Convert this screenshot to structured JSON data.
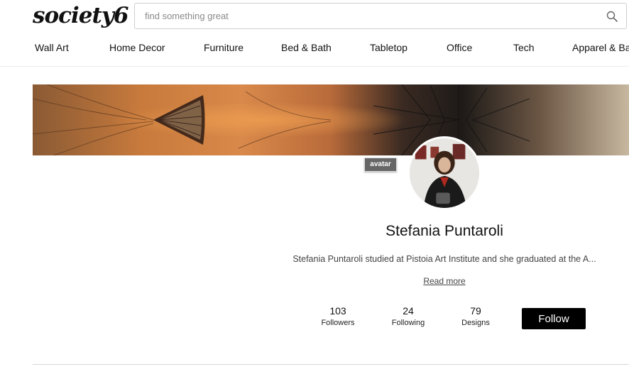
{
  "brand": {
    "logo_text": "society6"
  },
  "search": {
    "placeholder": "find something great",
    "value": ""
  },
  "nav": {
    "items": [
      "Wall Art",
      "Home Decor",
      "Furniture",
      "Bed & Bath",
      "Tabletop",
      "Office",
      "Tech",
      "Apparel & Bags"
    ]
  },
  "profile": {
    "avatar_tag": "avatar",
    "name": "Stefania Puntaroli",
    "bio": "Stefania Puntaroli studied at Pistoia Art Institute and she graduated at the A...",
    "read_more": "Read more",
    "stats": [
      {
        "value": "103",
        "label": "Followers"
      },
      {
        "value": "24",
        "label": "Following"
      },
      {
        "value": "79",
        "label": "Designs"
      }
    ],
    "follow_label": "Follow"
  },
  "icons": {
    "search": "search-icon"
  }
}
